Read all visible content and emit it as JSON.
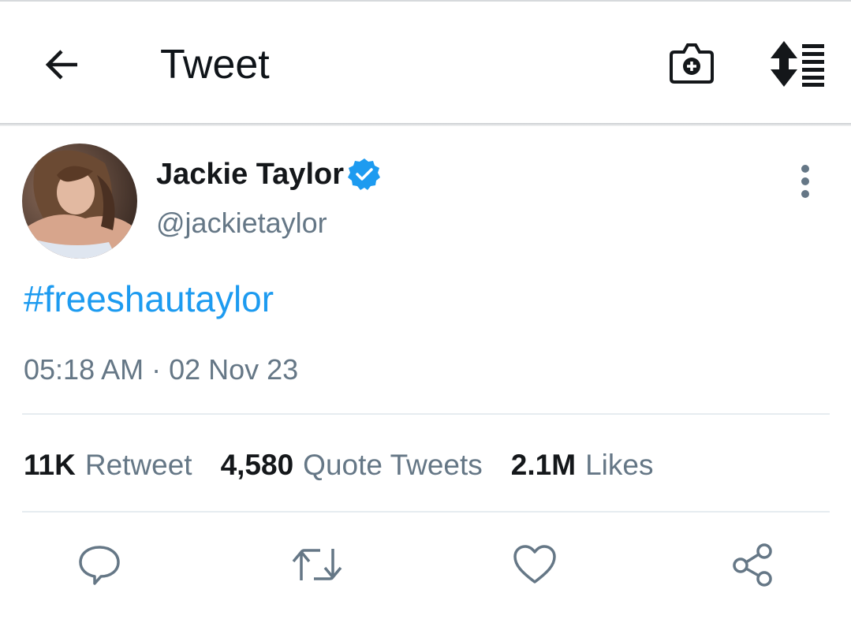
{
  "header": {
    "title": "Tweet",
    "icons": [
      "back-arrow-icon",
      "add-photo-camera-icon",
      "sort-list-icon"
    ]
  },
  "tweet": {
    "display_name": "Jackie Taylor",
    "handle": "@jackietaylor",
    "verified": true,
    "text": "#freeshautaylor",
    "timestamp": "05:18 AM · 02 Nov 23",
    "stats": [
      {
        "count": "11K",
        "label": "Retweet"
      },
      {
        "count": "4,580",
        "label": "Quote Tweets"
      },
      {
        "count": "2.1M",
        "label": "Likes"
      }
    ]
  },
  "actions": [
    "reply-icon",
    "retweet-icon",
    "like-icon",
    "share-icon"
  ],
  "colors": {
    "accent": "#1d9bf0",
    "text_primary": "#14171a",
    "text_secondary": "#657786",
    "divider": "#e6ecf0",
    "icon_gray": "#657786"
  }
}
